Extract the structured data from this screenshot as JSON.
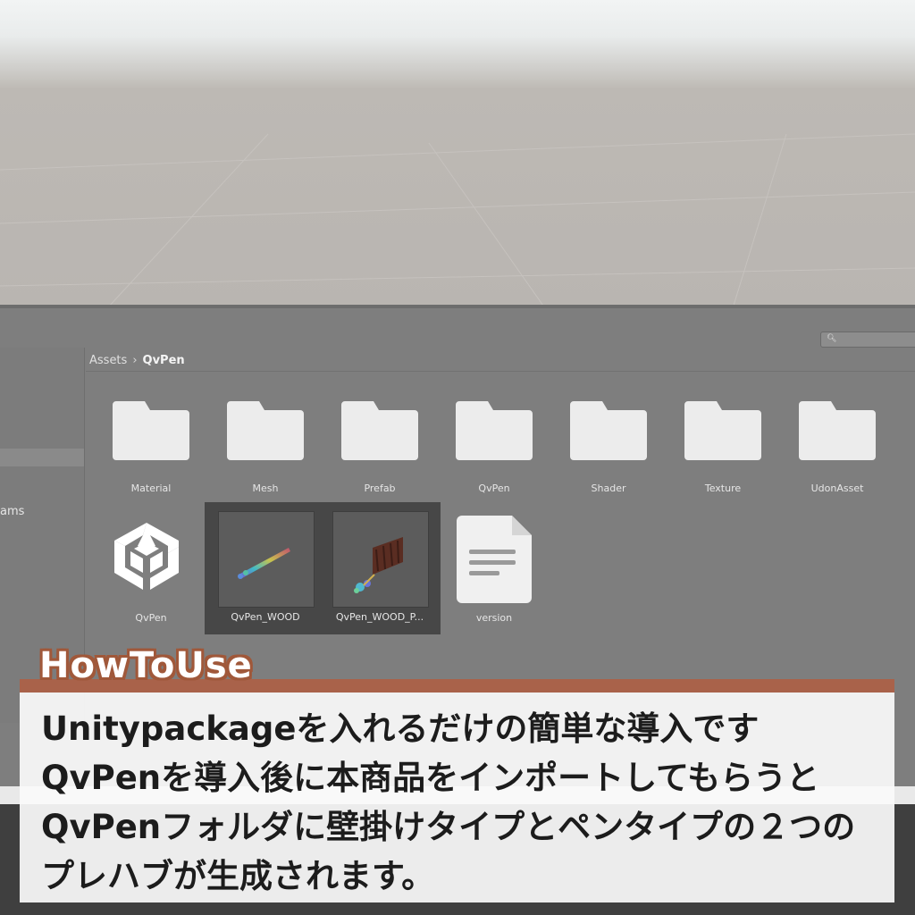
{
  "breadcrumb": {
    "root": "Assets",
    "current": "QvPen"
  },
  "left_pane": {
    "item": "ams"
  },
  "folders": [
    {
      "label": "Material"
    },
    {
      "label": "Mesh"
    },
    {
      "label": "Prefab"
    },
    {
      "label": "QvPen"
    },
    {
      "label": "Shader"
    },
    {
      "label": "Texture"
    },
    {
      "label": "UdonAsset"
    }
  ],
  "assets": [
    {
      "label": "QvPen",
      "icon": "unity-logo-icon"
    },
    {
      "label": "QvPen_WOOD",
      "icon": "prefab-thumbnail"
    },
    {
      "label": "QvPen_WOOD_P...",
      "icon": "prefab-thumbnail"
    },
    {
      "label": "version",
      "icon": "text-file-icon"
    }
  ],
  "caption": {
    "heading": "HowToUse",
    "lines": [
      "Unitypackageを入れるだけの簡単な導入です",
      "QvPenを導入後に本商品をインポートしてもらうと",
      "QvPenフォルダに壁掛けタイプとペンタイプの２つの",
      "プレハブが生成されます。"
    ]
  },
  "colors": {
    "accent": "#a9624a",
    "selection": "#474747",
    "panel": "#7e7e7e"
  }
}
